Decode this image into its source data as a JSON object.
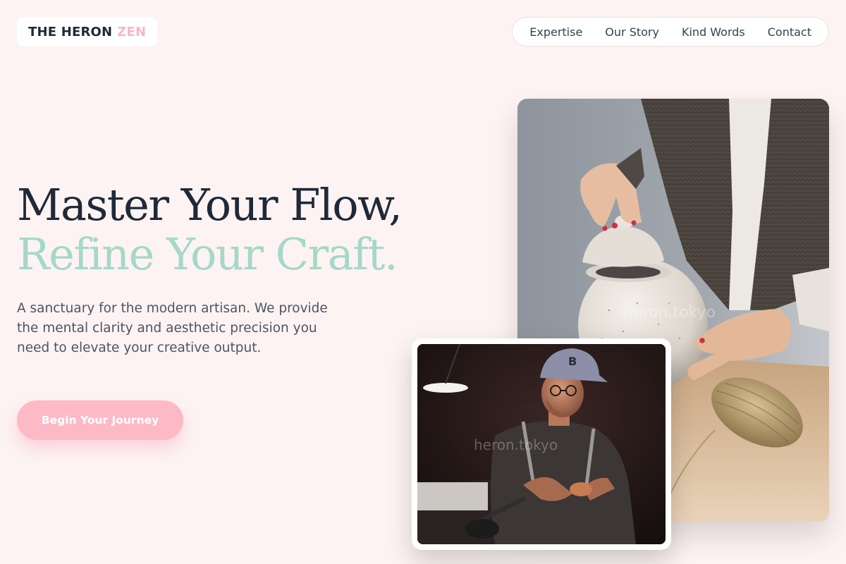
{
  "brand": {
    "name": "THE HERON",
    "accent": "ZEN"
  },
  "nav": {
    "items": [
      {
        "label": "Expertise"
      },
      {
        "label": "Our Story"
      },
      {
        "label": "Kind Words"
      },
      {
        "label": "Contact"
      }
    ]
  },
  "hero": {
    "headline_line1": "Master Your Flow,",
    "headline_line2": "Refine Your Craft.",
    "lead": "A sanctuary for the modern artisan. We provide the mental clarity and aesthetic precision you need to elevate your creative output.",
    "cta_label": "Begin Your Journey"
  },
  "images": {
    "main_watermark": "heron.tokyo",
    "small_watermark": "heron.tokyo"
  },
  "colors": {
    "background": "#fdf3f3",
    "brand_pink": "#f7b6c8",
    "headline_teal": "#a4d8ca",
    "cta_pink": "#feb9c7",
    "text_dark": "#1f2937"
  }
}
